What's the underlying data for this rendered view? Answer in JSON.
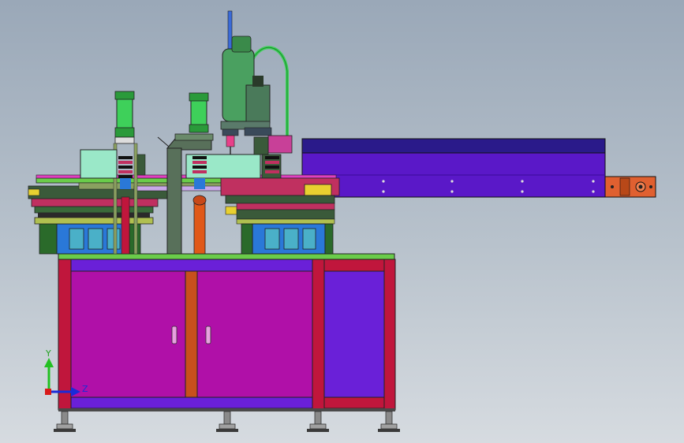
{
  "triad": {
    "y_label": "Y",
    "z_label": "Z",
    "colors": {
      "y": "#22c022",
      "z": "#1a2bd8",
      "x": "#d81a1a"
    }
  },
  "colors": {
    "cabinet_frame": "#c0163c",
    "cabinet_door": "#b010a8",
    "side_panel": "#6a20d8",
    "conveyor": "#5a18c8",
    "table_top": "#6acc4a",
    "robot": "#4aa060",
    "column": "#58705a",
    "cylinder": "#3ed05a",
    "hopper": "#2a78d8",
    "motor": "#e06030"
  }
}
